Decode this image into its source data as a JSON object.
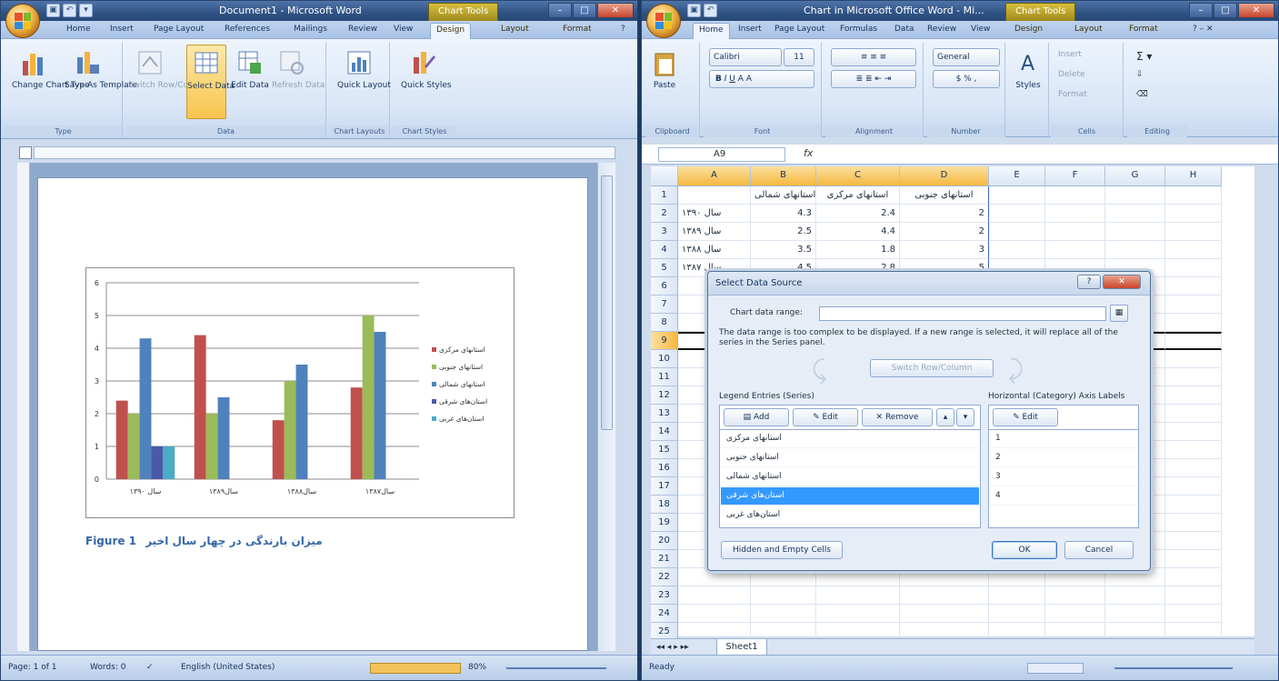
{
  "word": {
    "title": "Document1 - Microsoft Word",
    "context_tab": "Chart Tools",
    "tabs": [
      "Home",
      "Insert",
      "Page Layout",
      "References",
      "Mailings",
      "Review",
      "View",
      "Design",
      "Layout",
      "Format"
    ],
    "ribbon": {
      "change_chart_type": "Change Chart Type",
      "save_as_template": "Save As Template",
      "switch_row_col": "Switch Row/Column",
      "select_data": "Select Data",
      "edit_data": "Edit Data",
      "refresh_data": "Refresh Data",
      "quick_layout": "Quick Layout",
      "quick_styles": "Quick Styles",
      "group_type": "Type",
      "group_data": "Data",
      "group_chart_layouts": "Chart Layouts",
      "group_chart_styles": "Chart Styles"
    },
    "caption": "Figure 1",
    "caption_rtl": "میزان بارندگی در چهار سال اخیر",
    "status": {
      "page": "Page: 1 of 1",
      "words": "Words: 0",
      "language": "English (United States)",
      "zoom": "80%"
    }
  },
  "chart_data": {
    "type": "bar",
    "categories": [
      "سال ۱۳۹۰",
      "سال۱۳۸۹",
      "سال۱۳۸۸",
      "سال۱۳۸۷"
    ],
    "series": [
      {
        "name": "استانهای مرکزی",
        "color": "#c0504d",
        "values": [
          2.4,
          4.4,
          1.8,
          2.8
        ]
      },
      {
        "name": "استانهای جنوبی",
        "color": "#9bbb59",
        "values": [
          2,
          2,
          3,
          5
        ]
      },
      {
        "name": "استانهای شمالی",
        "color": "#4f81bd",
        "values": [
          4.3,
          2.5,
          3.5,
          4.5
        ]
      },
      {
        "name": "استان‌های شرقی",
        "color": "#4a5aa8",
        "values": [
          1,
          null,
          null,
          null
        ]
      },
      {
        "name": "استان‌های غربی",
        "color": "#4bacc6",
        "values": [
          1,
          null,
          null,
          null
        ]
      }
    ],
    "ylim": [
      0,
      6
    ],
    "yticks": [
      "0",
      "1",
      "2",
      "3",
      "4",
      "5",
      "6"
    ],
    "grid": true,
    "legend": "right"
  },
  "excel": {
    "title": "Chart in Microsoft Office Word - Mi...",
    "context_tab": "Chart Tools",
    "tabs": [
      "Home",
      "Insert",
      "Page Layout",
      "Formulas",
      "Data",
      "Review",
      "View",
      "Design",
      "Layout",
      "Format"
    ],
    "ribbon": {
      "paste": "Paste",
      "font": "Calibri",
      "font_size": "11",
      "number_format": "General",
      "styles": "Styles",
      "insert": "Insert",
      "delete": "Delete",
      "format": "Format",
      "group_clipboard": "Clipboard",
      "group_font": "Font",
      "group_alignment": "Alignment",
      "group_number": "Number",
      "group_cells": "Cells",
      "group_editing": "Editing"
    },
    "name_box": "A9",
    "fx": "fx",
    "columns": [
      "A",
      "B",
      "C",
      "D",
      "E",
      "F",
      "G",
      "H"
    ],
    "rows": [
      "1",
      "2",
      "3",
      "4",
      "5",
      "6",
      "7",
      "8",
      "9",
      "10",
      "11",
      "12",
      "13",
      "14",
      "15",
      "16",
      "17",
      "18",
      "19",
      "20",
      "21",
      "22",
      "23",
      "24",
      "25"
    ],
    "header_row": [
      "",
      "استانهای شمالی",
      "استانهای مرکزی",
      "استانهای جنوبی"
    ],
    "data_rows": [
      [
        "سال ۱۳۹۰",
        "4.3",
        "2.4",
        "2"
      ],
      [
        "سال ۱۳۸۹",
        "2.5",
        "4.4",
        "2"
      ],
      [
        "سال ۱۳۸۸",
        "3.5",
        "1.8",
        "3"
      ],
      [
        "سال ۱۳۸۷",
        "4.5",
        "2.8",
        "5"
      ]
    ],
    "sheet_tab": "Sheet1",
    "status": "Ready"
  },
  "dialog": {
    "title": "Select Data Source",
    "chart_range_label": "Chart data range:",
    "message": "The data range is too complex to be displayed. If a new range is selected, it will replace all of the series in the Series panel.",
    "switch_btn": "Switch Row/Column",
    "legend_label": "Legend Entries (Series)",
    "axis_label": "Horizontal (Category) Axis Labels",
    "add": "Add",
    "edit": "Edit",
    "remove": "Remove",
    "axis_edit": "Edit",
    "series": [
      "استانهای مرکزی",
      "استانهای جنوبی",
      "استانهای شمالی",
      "استان‌های شرقی",
      "استان‌های غربی"
    ],
    "selected_series_index": 3,
    "axis_items": [
      "1",
      "2",
      "3",
      "4"
    ],
    "hidden_cells": "Hidden and Empty Cells",
    "ok": "OK",
    "cancel": "Cancel"
  }
}
